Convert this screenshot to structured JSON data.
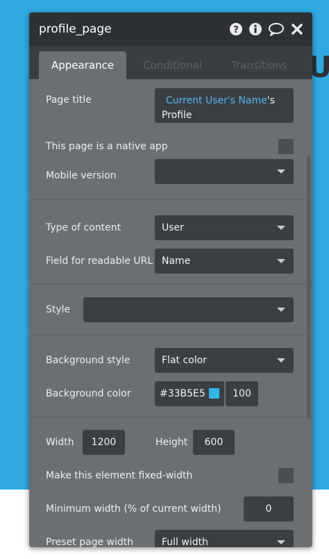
{
  "panel_title": "profile_page",
  "background_letter": "U",
  "tabs": [
    "Appearance",
    "Conditional",
    "Transitions"
  ],
  "page_title": {
    "label": "Page title",
    "dynamic": "Current User's Name",
    "suffix": "'s",
    "line2": "Profile"
  },
  "native_app": {
    "label": "This page is a native app"
  },
  "mobile_version": {
    "label": "Mobile version",
    "value": ""
  },
  "type_of_content": {
    "label": "Type of content",
    "value": "User"
  },
  "readable_url": {
    "label": "Field for readable URL",
    "value": "Name"
  },
  "style": {
    "label": "Style",
    "value": ""
  },
  "background_style": {
    "label": "Background style",
    "value": "Flat color"
  },
  "background_color": {
    "label": "Background color",
    "hex": "#33B5E5",
    "opacity": "100",
    "swatch": "#33b5e5"
  },
  "width": {
    "label": "Width",
    "value": "1200"
  },
  "height": {
    "label": "Height",
    "value": "600"
  },
  "fixed_width": {
    "label": "Make this element fixed-width"
  },
  "min_width": {
    "label": "Minimum width (% of current width)",
    "value": "0"
  },
  "preset_width": {
    "label": "Preset page width",
    "value": "Full width"
  },
  "icons": {
    "help": "question-circle-icon",
    "info": "info-circle-icon",
    "comment": "comment-icon",
    "close": "close-icon"
  }
}
